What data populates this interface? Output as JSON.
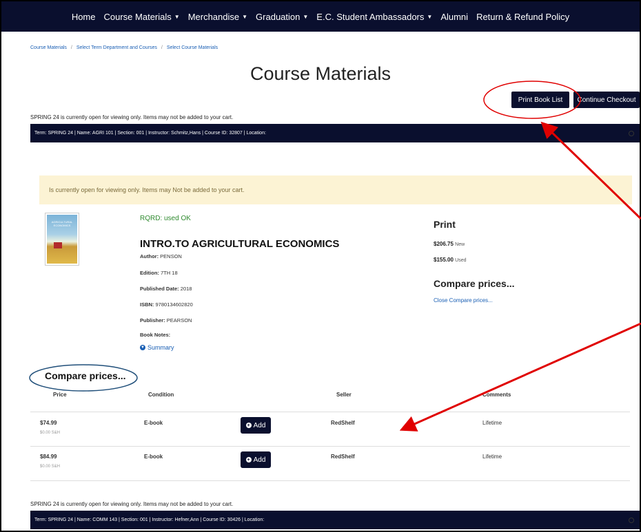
{
  "nav": {
    "items": [
      {
        "label": "Home",
        "dropdown": false
      },
      {
        "label": "Course Materials",
        "dropdown": true
      },
      {
        "label": "Merchandise",
        "dropdown": true
      },
      {
        "label": "Graduation",
        "dropdown": true
      },
      {
        "label": "E.C. Student Ambassadors",
        "dropdown": true
      },
      {
        "label": "Alumni",
        "dropdown": false
      },
      {
        "label": "Return & Refund Policy",
        "dropdown": false
      }
    ]
  },
  "breadcrumb": [
    "Course Materials",
    "Select Term Department and Courses",
    "Select Course Materials"
  ],
  "page_title": "Course Materials",
  "buttons": {
    "print": "Print Book List",
    "checkout": "Continue Checkout"
  },
  "notice": "SPRING 24 is currently open for viewing only. Items may not be added to your cart.",
  "term1": "Term: SPRING 24 | Name: AGRI 101 | Section: 001 | Instructor: Schmitz,Hans | Course ID: 32807 | Location:",
  "alert": "Is currently open for viewing only. Items may Not be added to your cart.",
  "book": {
    "cover_text": "AGRICULTURAL ECONOMICS",
    "requirement": "RQRD: used OK",
    "title": "INTRO.TO AGRICULTURAL ECONOMICS",
    "author_label": "Author:",
    "author": "PENSON",
    "edition_label": "Edition:",
    "edition": "7TH 18",
    "published_label": "Published Date:",
    "published": "2018",
    "isbn_label": "ISBN:",
    "isbn": "9780134602820",
    "publisher_label": "Publisher:",
    "publisher": "PEARSON",
    "notes_label": "Book Notes:",
    "summary": "Summary"
  },
  "pricing": {
    "heading": "Print",
    "new_price": "$206.75",
    "new_label": "New",
    "used_price": "$155.00",
    "used_label": "Used",
    "compare_heading": "Compare prices...",
    "close_compare": "Close Compare prices..."
  },
  "compare": {
    "heading": "Compare prices...",
    "headers": {
      "price": "Price",
      "condition": "Condition",
      "seller": "Seller",
      "comments": "Comments"
    },
    "rows": [
      {
        "price": "$74.99",
        "shipping": "$0.00 S&H",
        "condition": "E-book",
        "add": "Add",
        "seller": "RedShelf",
        "comments": "Lifetime"
      },
      {
        "price": "$84.99",
        "shipping": "$0.00 S&H",
        "condition": "E-book",
        "add": "Add",
        "seller": "RedShelf",
        "comments": "Lifetime"
      }
    ]
  },
  "notice2": "SPRING 24 is currently open for viewing only. Items may not be added to your cart.",
  "term2": "Term: SPRING 24 | Name: COMM 143 | Section: 001 | Instructor: Hefner,Ann | Course ID: 30426 | Location:",
  "colors": {
    "navy": "#0a0f2e",
    "annotation_red": "#e00000",
    "annotation_blue": "#1f4e79",
    "alert_bg": "#fcf3d4"
  }
}
